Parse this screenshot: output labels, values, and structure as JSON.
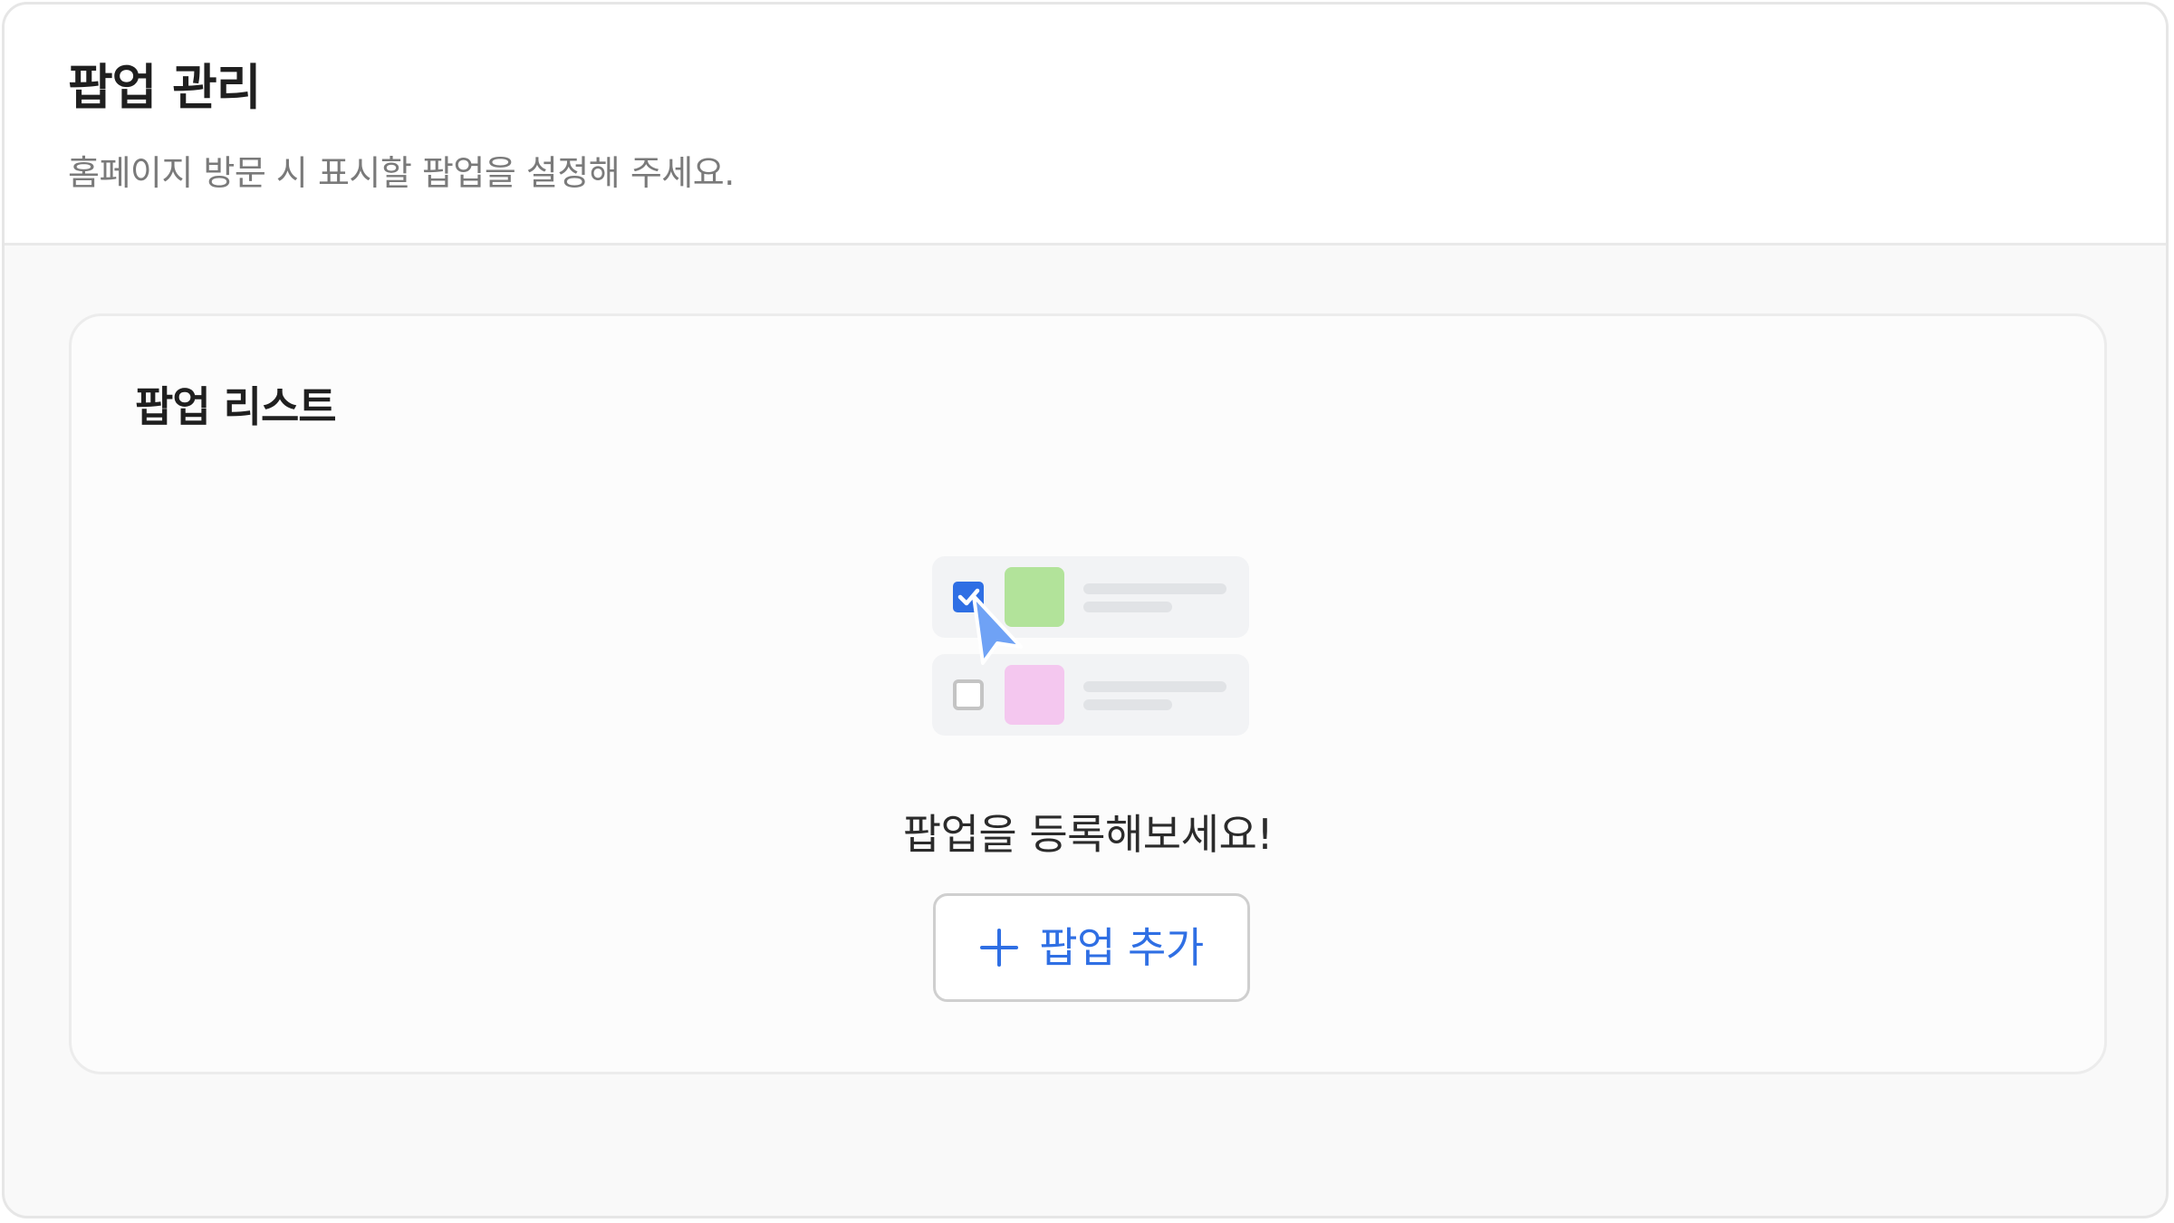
{
  "header": {
    "title": "팝업 관리",
    "subtitle": "홈페이지 방문 시 표시할 팝업을 설정해 주세요."
  },
  "popup_list": {
    "title": "팝업 리스트",
    "empty_message": "팝업을 등록해보세요!",
    "add_button_label": "팝업 추가",
    "add_button_icon": "plus-icon",
    "illustration": {
      "rows": [
        {
          "checked": true,
          "swatch_color": "#b2e39a"
        },
        {
          "checked": false,
          "swatch_color": "#f4c7ef"
        }
      ],
      "cursor_icon": "cursor-arrow-icon"
    }
  },
  "colors": {
    "accent": "#2f6fe4",
    "checkbox_checked": "#2f6fe4",
    "cursor": "#6fa2f5"
  }
}
